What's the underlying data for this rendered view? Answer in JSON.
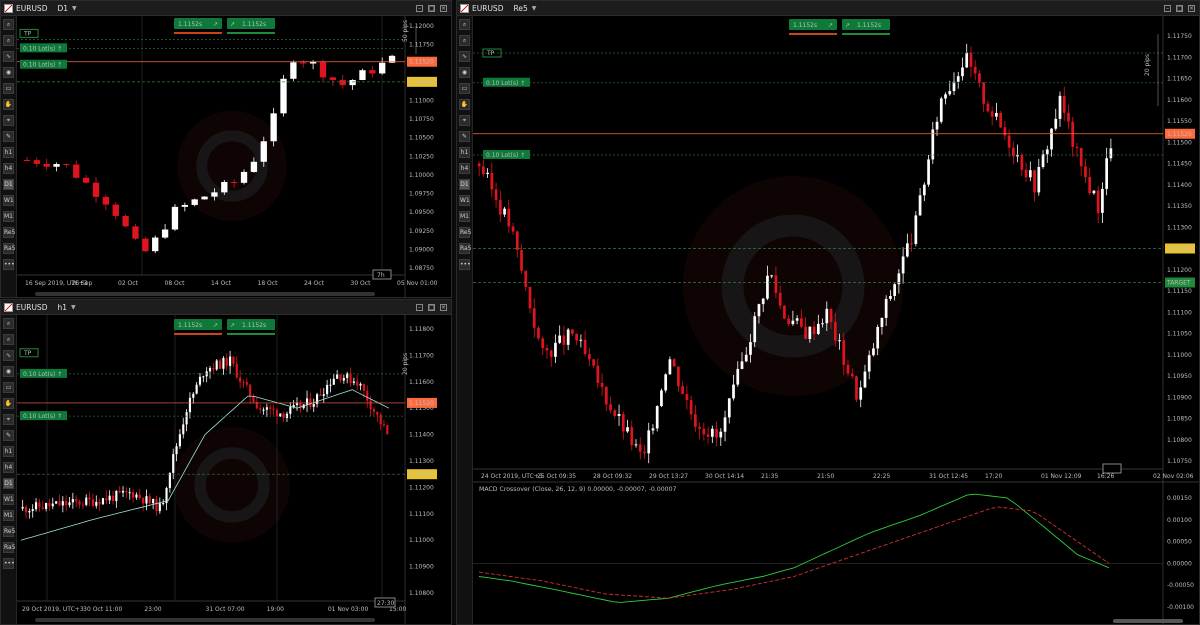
{
  "colors": {
    "bull": "#ffffff",
    "bear": "#e0141e",
    "bg": "#000000",
    "current": "#ff6a3d",
    "target": "#1f8a3a",
    "limit": "#e8c32f",
    "badge": "#0e7a39"
  },
  "toolbar_icons": [
    "zoom-in-icon",
    "zoom-out-icon",
    "indicator-icon",
    "sentiment-icon",
    "chart-type-icon",
    "hand-icon",
    "crosshair-icon",
    "draw-icon",
    "h1-icon",
    "h4-icon",
    "d1-icon",
    "w1-icon",
    "m1-icon",
    "re5-icon",
    "ra5-icon",
    "more-icon"
  ],
  "toolbar_labels": [
    "",
    "",
    "",
    "",
    "",
    "",
    "",
    "",
    "h",
    "h",
    "D",
    "W",
    "M",
    "Re",
    "Ra",
    "•••"
  ],
  "toolbar_subs": [
    "",
    "",
    "",
    "",
    "",
    "",
    "",
    "",
    "1",
    "4",
    "1",
    "1",
    "1",
    "5",
    "5",
    ""
  ],
  "common": {
    "sell_price": "1.1152s",
    "buy_price": "1.1152s",
    "lots": "0.10 Lot(s)",
    "tp": "TP",
    "pips": "20 pips",
    "current": "1.11520",
    "limit": "1.11250",
    "target": "TARGET"
  },
  "pane_d1": {
    "symbol": "EURUSD",
    "timeframe": "D1",
    "pips": "50 pips",
    "timer": "7h",
    "yticks": [
      "1.12000",
      "1.11750",
      "1.11500",
      "1.11250",
      "1.11000",
      "1.10750",
      "1.10500",
      "1.10250",
      "1.10000",
      "1.09750",
      "1.09500",
      "1.09250",
      "1.09000",
      "1.08750"
    ],
    "xticks": [
      "16 Sep 2019, UTC+3",
      "26 Sep",
      "02 Oct",
      "08 Oct",
      "14 Oct",
      "18 Oct",
      "24 Oct",
      "30 Oct",
      "05 Nov 01:00"
    ]
  },
  "pane_h1": {
    "symbol": "EURUSD",
    "timeframe": "h1",
    "timer": "27:30",
    "yticks": [
      "1.11800",
      "1.11700",
      "1.11600",
      "1.11500",
      "1.11400",
      "1.11300",
      "1.11200",
      "1.11100",
      "1.11000",
      "1.10900",
      "1.10800"
    ],
    "xticks": [
      "29 Oct 2019, UTC+3",
      "30 Oct 11:00",
      "23:00",
      "31 Oct 07:00",
      "19:00",
      "01 Nov 03:00",
      "15:00"
    ]
  },
  "pane_re5": {
    "symbol": "EURUSD",
    "timeframe": "Re5",
    "timer": "16:26",
    "yticks": [
      "1.11750",
      "1.11700",
      "1.11650",
      "1.11600",
      "1.11550",
      "1.11500",
      "1.11450",
      "1.11400",
      "1.11350",
      "1.11300",
      "1.11250",
      "1.11200",
      "1.11150",
      "1.11100",
      "1.11050",
      "1.11000",
      "1.10950",
      "1.10900",
      "1.10850",
      "1.10800",
      "1.10750"
    ],
    "xticks": [
      "24 Oct 2019, UTC+3",
      "25 Oct 09:35",
      "28 Oct 09:32",
      "29 Oct 13:27",
      "30 Oct 14:14",
      "21:35",
      "21:50",
      "22:25",
      "31 Oct 12:45",
      "17:20",
      "01 Nov 12:09",
      "16:26",
      "02 Nov 02:06"
    ],
    "macd_title": "MACD Crossover (Close, 26, 12, 9) 0.00000, -0.00007, -0.00007",
    "macd_yticks": [
      "0.00150",
      "0.00100",
      "0.00050",
      "0.00000",
      "-0.00050",
      "-0.00100"
    ]
  }
}
